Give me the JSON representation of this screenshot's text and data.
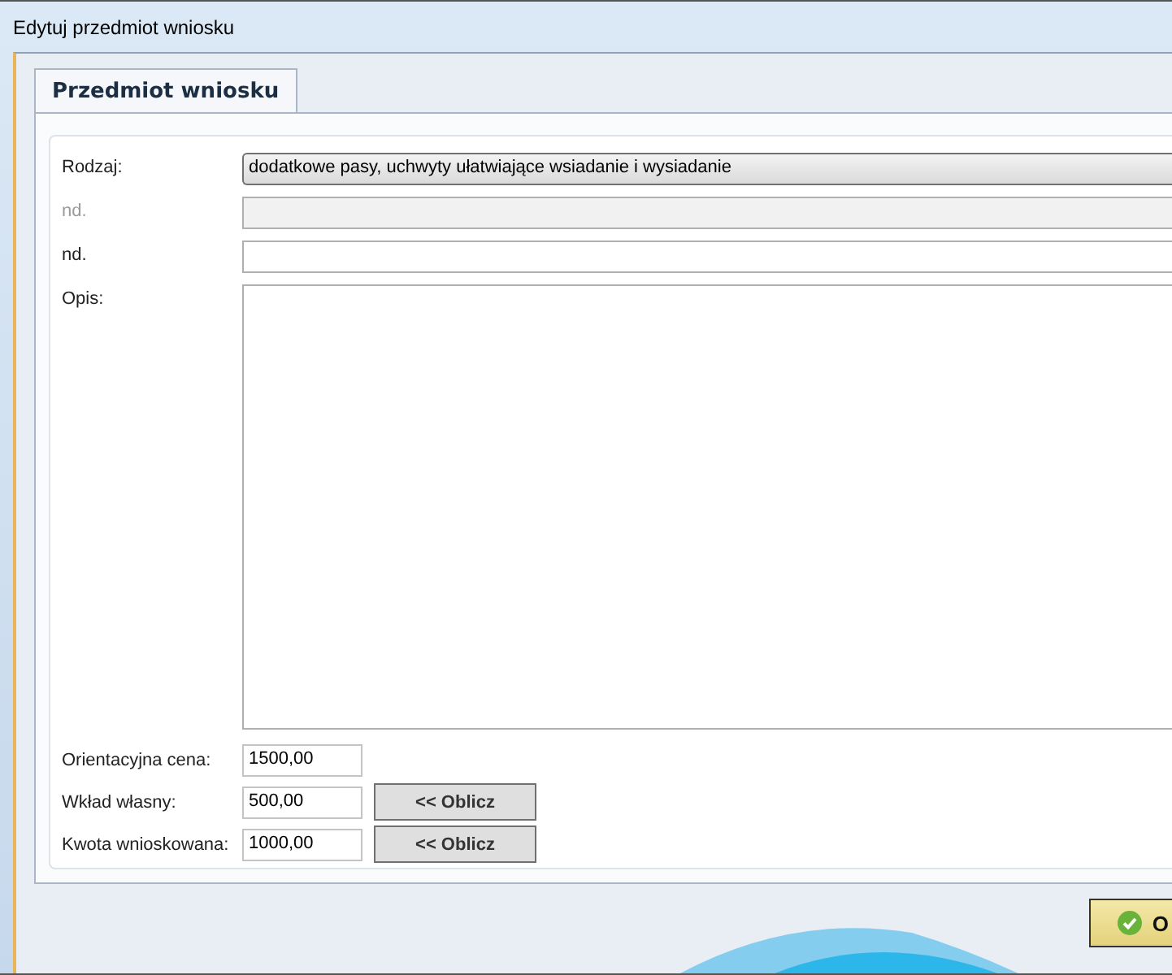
{
  "window": {
    "title": "Edytuj przedmiot wniosku"
  },
  "tabs": [
    {
      "label": "Przedmiot wniosku",
      "selected": true
    }
  ],
  "fields": [
    {
      "label": "Rodzaj:",
      "kind": "combo",
      "value": "dodatkowe pasy, uchwyty ułatwiające wsiadanie i wysiadanie",
      "disabled": false
    },
    {
      "label": "nd.",
      "kind": "text",
      "disabled": true
    },
    {
      "label": "nd.",
      "kind": "text",
      "disabled": false
    },
    {
      "label": "Opis:",
      "kind": "area",
      "disabled": false
    }
  ],
  "amounts": [
    {
      "label": "Orientacyjna cena:",
      "value": "1500,00"
    },
    {
      "label": "Wkład własny:",
      "value": "500,00",
      "button": "<< Oblicz"
    },
    {
      "label": "Kwota wnioskowana:",
      "value": "1000,00",
      "button": "<< Oblicz"
    }
  ],
  "ok_button": {
    "label": "O"
  }
}
